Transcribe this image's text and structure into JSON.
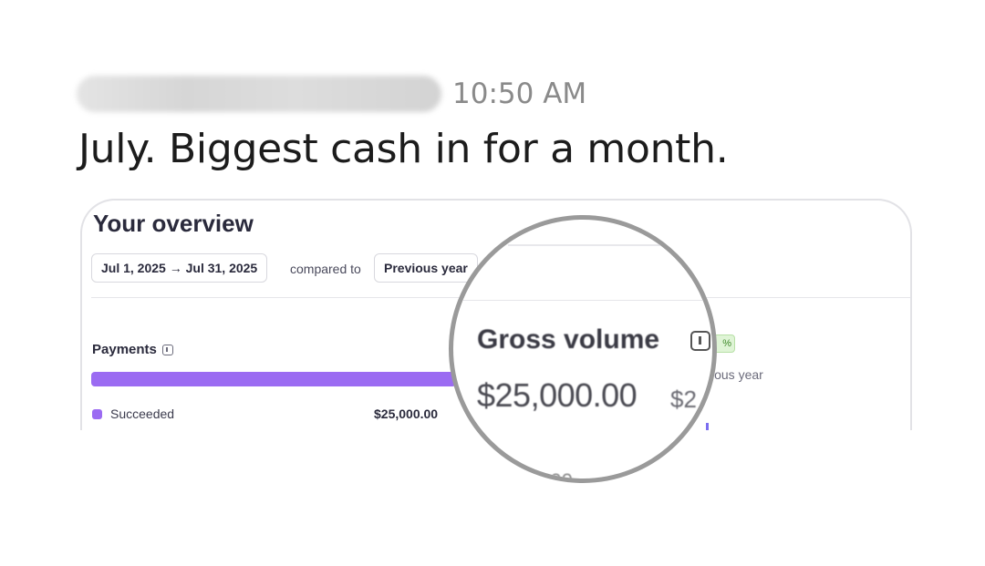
{
  "message": {
    "time": "10:50 AM",
    "text": "July. Biggest cash in for a month."
  },
  "overview": {
    "title": "Your overview",
    "date_range": "Jul 1, 2025 → Jul 31, 2025",
    "compared_label": "compared to",
    "comparison": "Previous year",
    "payments": {
      "label": "Payments",
      "legend_label": "Succeeded",
      "succeeded_value": "$25,000.00",
      "bar_color": "#9b6bf2"
    },
    "right_panel": {
      "badge_fragment": "%",
      "prev_fragment": "ious year"
    }
  },
  "magnifier": {
    "title": "Gross volume",
    "value": "$25,000.00",
    "partial_value": "$2",
    "bottom_fragment": "0.00"
  }
}
